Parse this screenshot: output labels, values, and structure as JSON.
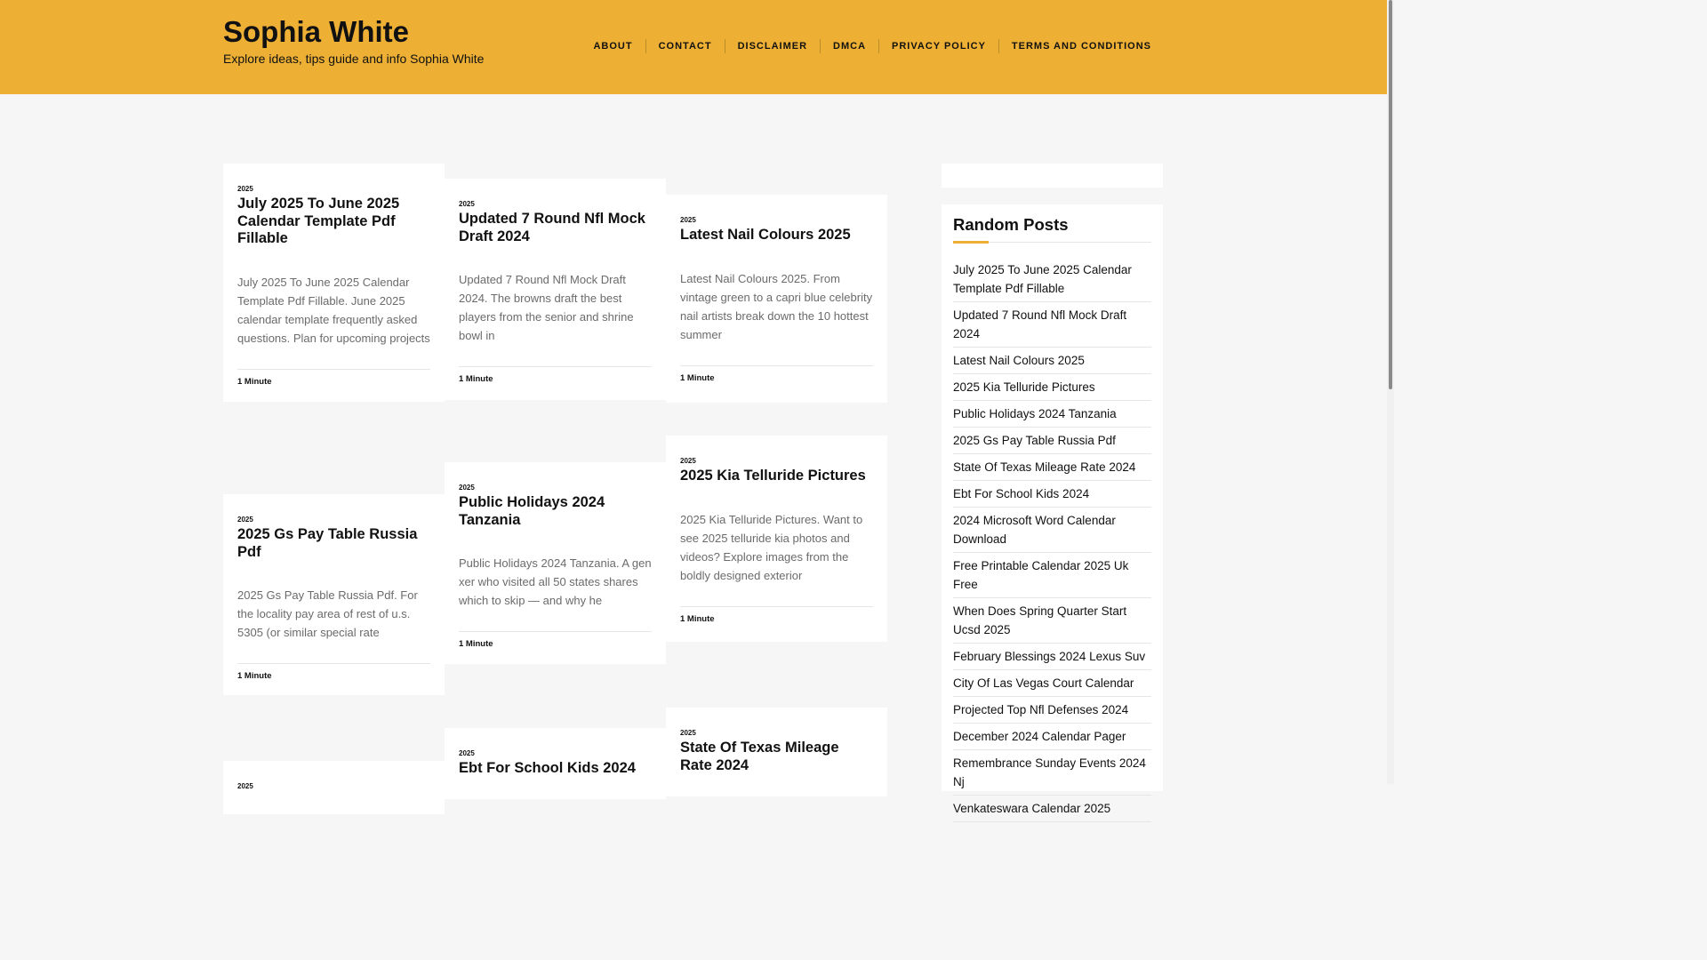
{
  "site": {
    "title": "Sophia White",
    "description": "Explore ideas, tips guide and info Sophia White"
  },
  "nav": [
    "ABOUT",
    "CONTACT",
    "DISCLAIMER",
    "DMCA",
    "PRIVACY POLICY",
    "TERMS AND CONDITIONS"
  ],
  "colors": {
    "accent": "#edb035",
    "background": "#f6f6f6",
    "card": "#ffffff"
  },
  "posts": [
    {
      "category": "2025",
      "title": "July 2025 To June 2025 Calendar Template Pdf Fillable",
      "excerpt": "July 2025 To June 2025 Calendar Template Pdf Fillable. June 2025 calendar template frequently asked questions. Plan for upcoming projects",
      "read_time": "1 Minute"
    },
    {
      "category": "2025",
      "title": "Updated 7 Round Nfl Mock Draft 2024",
      "excerpt": "Updated 7 Round Nfl Mock Draft 2024. The browns draft the best players from the senior and shrine bowl in",
      "read_time": "1 Minute"
    },
    {
      "category": "2025",
      "title": "Latest Nail Colours 2025",
      "excerpt": "Latest Nail Colours 2025. From vintage green to a capri blue celebrity nail artists break down the 10 hottest summer",
      "read_time": "1 Minute"
    },
    {
      "category": "2025",
      "title": "2025 Gs Pay Table Russia Pdf",
      "excerpt": "2025 Gs Pay Table Russia Pdf. For the locality pay area of rest of u.s. 5305 (or similar special rate",
      "read_time": "1 Minute"
    },
    {
      "category": "2025",
      "title": "Public Holidays 2024 Tanzania",
      "excerpt": "Public Holidays 2024 Tanzania. A gen xer who visited all 50 states shares which to skip — and why he",
      "read_time": "1 Minute"
    },
    {
      "category": "2025",
      "title": "2025 Kia Telluride Pictures",
      "excerpt": "2025 Kia Telluride Pictures. Want to see 2025 telluride kia photos and videos? Explore images from the boldly designed exterior",
      "read_time": "1 Minute"
    },
    {
      "category": "2025",
      "title": "",
      "excerpt": "",
      "read_time": ""
    },
    {
      "category": "2025",
      "title": "Ebt For School Kids 2024",
      "excerpt": "",
      "read_time": ""
    },
    {
      "category": "2025",
      "title": "State Of Texas Mileage Rate 2024",
      "excerpt": "",
      "read_time": ""
    }
  ],
  "sidebar": {
    "title": "Random Posts",
    "items": [
      "July 2025 To June 2025 Calendar Template Pdf Fillable",
      "Updated 7 Round Nfl Mock Draft 2024",
      "Latest Nail Colours 2025",
      "2025 Kia Telluride Pictures",
      "Public Holidays 2024 Tanzania",
      "2025 Gs Pay Table Russia Pdf",
      "State Of Texas Mileage Rate 2024",
      "Ebt For School Kids 2024",
      "2024 Microsoft Word Calendar Download",
      "Free Printable Calendar 2025 Uk Free",
      "When Does Spring Quarter Start Ucsd 2025",
      "February Blessings 2024 Lexus Suv",
      "City Of Las Vegas Court Calendar",
      "Projected Top Nfl Defenses 2024",
      "December 2024 Calendar Pager",
      "Remembrance Sunday Events 2024 Nj",
      "Venkateswara Calendar 2025"
    ]
  }
}
